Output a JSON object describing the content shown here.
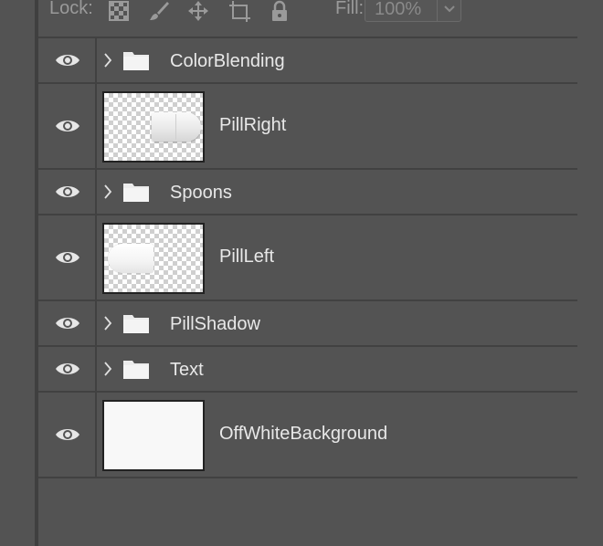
{
  "lock_bar": {
    "lock_label": "Lock:",
    "fill_label": "Fill:",
    "fill_value": "100%",
    "icons": [
      "lock-transparent-pixels-icon",
      "lock-image-pixels-icon",
      "lock-position-icon",
      "lock-artboard-icon",
      "lock-all-icon"
    ]
  },
  "layers": [
    {
      "type": "group",
      "name": "ColorBlending",
      "visible": true,
      "icon": "folder-icon"
    },
    {
      "type": "pixel",
      "name": "PillRight",
      "visible": true,
      "thumbnail": "pill-right"
    },
    {
      "type": "group",
      "name": "Spoons",
      "visible": true,
      "icon": "folder-icon"
    },
    {
      "type": "pixel",
      "name": "PillLeft",
      "visible": true,
      "thumbnail": "pill-left"
    },
    {
      "type": "group",
      "name": "PillShadow",
      "visible": true,
      "icon": "folder-icon"
    },
    {
      "type": "group",
      "name": "Text",
      "visible": true,
      "icon": "folder-icon"
    },
    {
      "type": "pixel",
      "name": "OffWhiteBackground",
      "visible": true,
      "thumbnail": "solid-offwhite"
    }
  ],
  "colors": {
    "panel_bg": "#535353",
    "row_border": "#414141",
    "text": "#e8e8e8",
    "disabled_text": "#9a9a9a"
  }
}
